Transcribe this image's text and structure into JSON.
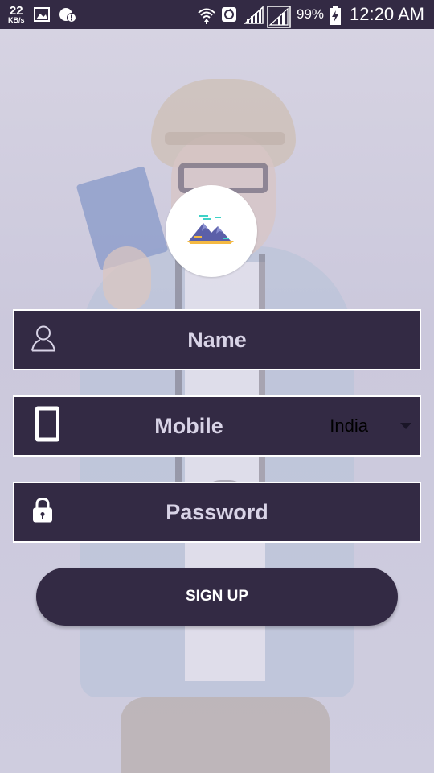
{
  "status_bar": {
    "net_speed_value": "22",
    "net_speed_unit": "KB/s",
    "battery_percent": "99%",
    "time": "12:20 AM",
    "icons": [
      "gallery-icon",
      "alert-icon",
      "wifi-icon",
      "sync-icon",
      "signal-icon",
      "signal-icon",
      "battery-charging-icon"
    ]
  },
  "logo": {
    "icon": "mountains-logo-icon"
  },
  "form": {
    "name_label": "Name",
    "name_icon": "user-icon",
    "mobile_label": "Mobile",
    "mobile_icon": "phone-icon",
    "country_selected": "India",
    "password_label": "Password",
    "password_icon": "lock-icon",
    "signup_label": "SIGN UP"
  },
  "colors": {
    "primary": "#332a44",
    "background_tint": "#cfcddf",
    "field_text": "#d8d3e6",
    "border": "#ffffff"
  }
}
